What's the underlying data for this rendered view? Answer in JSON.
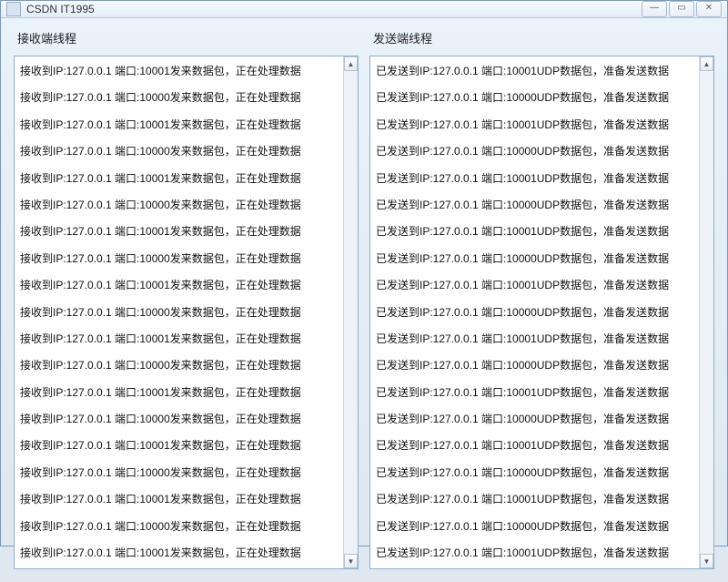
{
  "window": {
    "title": "CSDN IT1995"
  },
  "leftPanel": {
    "title": "接收端线程",
    "lines": [
      "接收到IP:127.0.0.1 端口:10001发来数据包，正在处理数据",
      "接收到IP:127.0.0.1 端口:10000发来数据包，正在处理数据",
      "接收到IP:127.0.0.1 端口:10001发来数据包，正在处理数据",
      "接收到IP:127.0.0.1 端口:10000发来数据包，正在处理数据",
      "接收到IP:127.0.0.1 端口:10001发来数据包，正在处理数据",
      "接收到IP:127.0.0.1 端口:10000发来数据包，正在处理数据",
      "接收到IP:127.0.0.1 端口:10001发来数据包，正在处理数据",
      "接收到IP:127.0.0.1 端口:10000发来数据包，正在处理数据",
      "接收到IP:127.0.0.1 端口:10001发来数据包，正在处理数据",
      "接收到IP:127.0.0.1 端口:10000发来数据包，正在处理数据",
      "接收到IP:127.0.0.1 端口:10001发来数据包，正在处理数据",
      "接收到IP:127.0.0.1 端口:10000发来数据包，正在处理数据",
      "接收到IP:127.0.0.1 端口:10001发来数据包，正在处理数据",
      "接收到IP:127.0.0.1 端口:10000发来数据包，正在处理数据",
      "接收到IP:127.0.0.1 端口:10001发来数据包，正在处理数据",
      "接收到IP:127.0.0.1 端口:10000发来数据包，正在处理数据",
      "接收到IP:127.0.0.1 端口:10001发来数据包，正在处理数据",
      "接收到IP:127.0.0.1 端口:10000发来数据包，正在处理数据",
      "接收到IP:127.0.0.1 端口:10001发来数据包，正在处理数据"
    ]
  },
  "rightPanel": {
    "title": "发送端线程",
    "lines": [
      "已发送到IP:127.0.0.1 端口:10001UDP数据包，准备发送数据",
      "已发送到IP:127.0.0.1 端口:10000UDP数据包，准备发送数据",
      "已发送到IP:127.0.0.1 端口:10001UDP数据包，准备发送数据",
      "已发送到IP:127.0.0.1 端口:10000UDP数据包，准备发送数据",
      "已发送到IP:127.0.0.1 端口:10001UDP数据包，准备发送数据",
      "已发送到IP:127.0.0.1 端口:10000UDP数据包，准备发送数据",
      "已发送到IP:127.0.0.1 端口:10001UDP数据包，准备发送数据",
      "已发送到IP:127.0.0.1 端口:10000UDP数据包，准备发送数据",
      "已发送到IP:127.0.0.1 端口:10001UDP数据包，准备发送数据",
      "已发送到IP:127.0.0.1 端口:10000UDP数据包，准备发送数据",
      "已发送到IP:127.0.0.1 端口:10001UDP数据包，准备发送数据",
      "已发送到IP:127.0.0.1 端口:10000UDP数据包，准备发送数据",
      "已发送到IP:127.0.0.1 端口:10001UDP数据包，准备发送数据",
      "已发送到IP:127.0.0.1 端口:10000UDP数据包，准备发送数据",
      "已发送到IP:127.0.0.1 端口:10001UDP数据包，准备发送数据",
      "已发送到IP:127.0.0.1 端口:10000UDP数据包，准备发送数据",
      "已发送到IP:127.0.0.1 端口:10001UDP数据包，准备发送数据",
      "已发送到IP:127.0.0.1 端口:10000UDP数据包，准备发送数据",
      "已发送到IP:127.0.0.1 端口:10001UDP数据包，准备发送数据"
    ]
  }
}
